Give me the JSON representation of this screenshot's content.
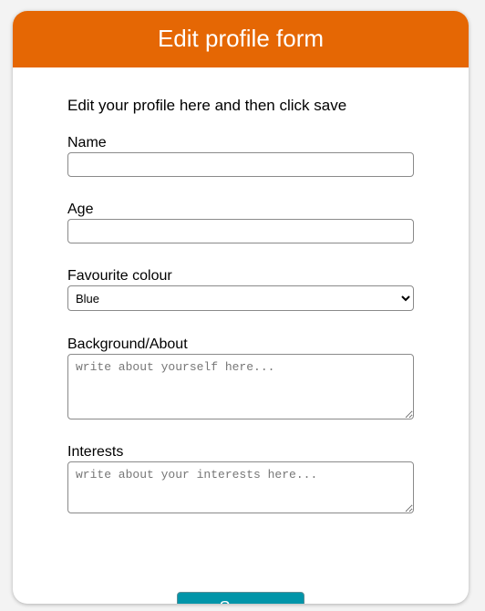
{
  "form": {
    "title": "Edit profile form",
    "intro": "Edit your profile here and then click save",
    "name": {
      "label": "Name",
      "value": ""
    },
    "age": {
      "label": "Age",
      "value": ""
    },
    "colour": {
      "label": "Favourite colour",
      "selected": "Blue"
    },
    "background": {
      "label": "Background/About",
      "placeholder": "write about yourself here..."
    },
    "interests": {
      "label": "Interests",
      "placeholder": "write about your interests here..."
    },
    "save_label": "Save"
  },
  "colors": {
    "header": "#e56704",
    "button": "#0195a9"
  }
}
